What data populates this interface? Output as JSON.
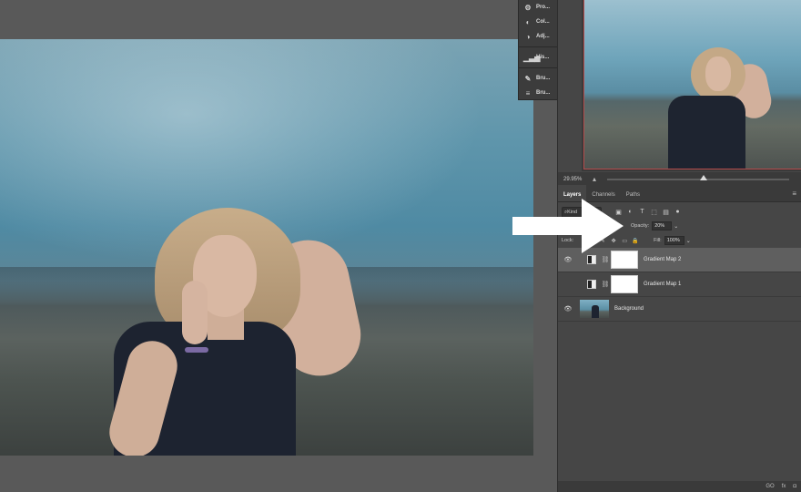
{
  "dock": {
    "items": [
      {
        "icon": "properties-icon",
        "label": "Pro..."
      },
      {
        "icon": "color-icon",
        "label": "Col..."
      },
      {
        "icon": "adjustments-icon",
        "label": "Adj..."
      },
      {
        "icon": "histogram-icon",
        "label": "His..."
      },
      {
        "icon": "brush-icon",
        "label": "Bru..."
      },
      {
        "icon": "brush-settings-icon",
        "label": "Bru..."
      }
    ]
  },
  "navigator": {
    "zoom": "29.95%",
    "zoom_level_fraction": 0.53
  },
  "layers_panel": {
    "tabs": [
      "Layers",
      "Channels",
      "Paths"
    ],
    "active_tab": "Layers",
    "kind_filter": "Kind",
    "opacity_label": "Opacity:",
    "opacity_value": "20%",
    "lock_label": "Lock:",
    "fill_label": "Fill:",
    "fill_value": "100%",
    "layers": [
      {
        "name": "Gradient Map 2",
        "visible": true,
        "selected": true
      },
      {
        "name": "Gradient Map 1",
        "visible": false,
        "selected": false
      },
      {
        "name": "Background",
        "visible": true,
        "selected": false
      }
    ],
    "footer": {
      "link": "GO",
      "fx": "fx"
    }
  },
  "colors": {
    "panel_bg": "#464646",
    "selected_layer": "#5f5f5f",
    "navigator_frame": "#b44b4b",
    "arrow": "#ffffff"
  }
}
